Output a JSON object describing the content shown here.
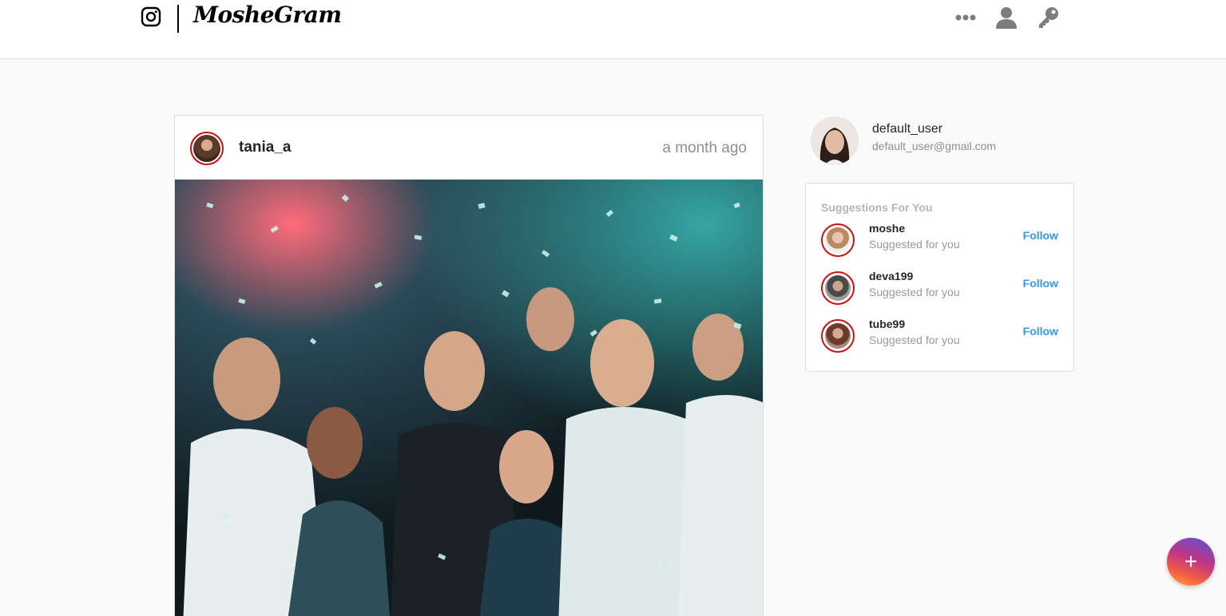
{
  "header": {
    "brand": "MosheGram",
    "icons": [
      "instagram-icon",
      "more-icon",
      "user-icon",
      "key-icon"
    ]
  },
  "post": {
    "username": "tania_a",
    "time": "a month ago"
  },
  "profile": {
    "username": "default_user",
    "email": "default_user@gmail.com"
  },
  "suggestions": {
    "title": "Suggestions For You",
    "items": [
      {
        "username": "moshe",
        "subtitle": "Suggested for you",
        "action": "Follow"
      },
      {
        "username": "deva199",
        "subtitle": "Suggested for you",
        "action": "Follow"
      },
      {
        "username": "tube99",
        "subtitle": "Suggested for you",
        "action": "Follow"
      }
    ]
  },
  "fab": {
    "label": "+"
  },
  "colors": {
    "accent": "#3897f0",
    "avatar_ring": "#d20f0f"
  }
}
